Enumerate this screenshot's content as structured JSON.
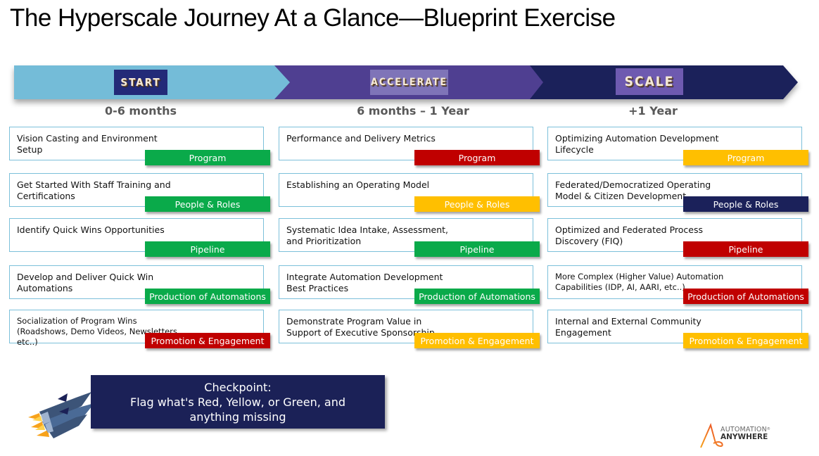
{
  "title": "The Hyperscale Journey At a Glance—Blueprint Exercise",
  "colors": {
    "start_band": "#74bcd8",
    "accelerate_band": "#4f3f91",
    "scale_band": "#1b215a",
    "card_border": "#7cc0da",
    "green": "#0aaa4a",
    "red": "#c00000",
    "yellow": "#ffbf00",
    "navy": "#1b215a",
    "checkpoint_bg": "#1b2157"
  },
  "phases": [
    {
      "name": "START",
      "range": "0-6 months",
      "items": [
        {
          "text": "Vision Casting and Environment Setup",
          "tag": "Program",
          "status": "green"
        },
        {
          "text": "Get Started With Staff Training and Certifications",
          "tag": "People & Roles",
          "status": "green"
        },
        {
          "text": "Identify Quick Wins Opportunities",
          "tag": "Pipeline",
          "status": "green"
        },
        {
          "text": "Develop and Deliver Quick Win Automations",
          "tag": "Production of Automations",
          "status": "green"
        },
        {
          "text": "Socialization of Program Wins (Roadshows, Demo Videos, Newsletters, etc..)",
          "tag": "Promotion & Engagement",
          "status": "red"
        }
      ]
    },
    {
      "name": "ACCELERATE",
      "range": "6 months – 1 Year",
      "items": [
        {
          "text": "Performance and Delivery Metrics",
          "tag": "Program",
          "status": "red"
        },
        {
          "text": "Establishing an Operating Model",
          "tag": "People & Roles",
          "status": "yellow"
        },
        {
          "text": "Systematic Idea Intake, Assessment, and Prioritization",
          "tag": "Pipeline",
          "status": "green"
        },
        {
          "text": "Integrate Automation Development Best Practices",
          "tag": "Production of Automations",
          "status": "green"
        },
        {
          "text": "Demonstrate Program Value in Support of Executive Sponsorship",
          "tag": "Promotion & Engagement",
          "status": "yellow"
        }
      ]
    },
    {
      "name": "SCALE",
      "range": "+1 Year",
      "items": [
        {
          "text": "Optimizing Automation Development Lifecycle",
          "tag": "Program",
          "status": "yellow"
        },
        {
          "text": "Federated/Democratized Operating Model & Citizen Development",
          "tag": "People & Roles",
          "status": "navy"
        },
        {
          "text": "Optimized and Federated Process Discovery (FIQ)",
          "tag": "Pipeline",
          "status": "red"
        },
        {
          "text": "More Complex (Higher Value) Automation Capabilities (IDP, AI, AARI, etc..)",
          "tag": "Production of Automations",
          "status": "red"
        },
        {
          "text": "Internal and External Community Engagement",
          "tag": "Promotion & Engagement",
          "status": "yellow"
        }
      ]
    }
  ],
  "checkpoint": {
    "heading": "Checkpoint:",
    "body": "Flag what's Red, Yellow, or Green, and anything missing"
  },
  "logo": {
    "line1": "AUTOMATION",
    "line2": "ANYWHERE",
    "reg": "®",
    "icon": "automation-anywhere-a-icon"
  },
  "icons": {
    "rockets": "rockets-icon"
  }
}
